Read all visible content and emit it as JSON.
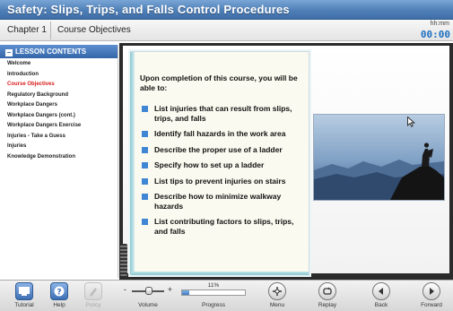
{
  "window": {
    "title": "Safety: Slips, Trips, and Falls Control Procedures"
  },
  "subheader": {
    "chapter": "Chapter 1",
    "topic": "Course Objectives",
    "timer_label": "hh:mm",
    "timer_value": "00:00"
  },
  "sidebar": {
    "title": "LESSON CONTENTS",
    "items": [
      {
        "label": "Welcome"
      },
      {
        "label": "Introduction"
      },
      {
        "label": "Course Objectives",
        "active": true
      },
      {
        "label": "Regulatory Background"
      },
      {
        "label": "Workplace Dangers"
      },
      {
        "label": "Workplace Dangers (cont.)"
      },
      {
        "label": "Workplace Dangers Exercise"
      },
      {
        "label": "Injuries - Take a Guess"
      },
      {
        "label": "Injuries"
      },
      {
        "label": "Knowledge Demonstration"
      }
    ]
  },
  "content": {
    "intro": "Upon completion of this course, you will be able to:",
    "objectives": [
      "List injuries that can result from slips, trips, and falls",
      "Identify fall hazards in the work area",
      "Describe the proper use of a ladder",
      "Specify how to set up a ladder",
      "List tips to prevent injuries on stairs",
      "Describe how to minimize walkway hazards",
      "List contributing factors to slips, trips, and falls"
    ]
  },
  "toolbar": {
    "tutorial": "Tutorial",
    "help": "Help",
    "policy": "Policy",
    "volume": "Volume",
    "progress_label": "Progress",
    "progress_value": "11%",
    "progress_fraction": 0.11,
    "menu": "Menu",
    "replay": "Replay",
    "back": "Back",
    "forward": "Forward"
  },
  "colors": {
    "title_bar": "#4f7fb7",
    "active_item": "#d81b1b",
    "bullet": "#3f86d4",
    "timer": "#1e6fbf"
  },
  "icons": {
    "tutorial": "tutorial-icon",
    "help": "help-icon",
    "policy": "policy-icon",
    "menu": "menu-icon",
    "replay": "replay-icon",
    "back": "back-icon",
    "forward": "forward-icon"
  }
}
